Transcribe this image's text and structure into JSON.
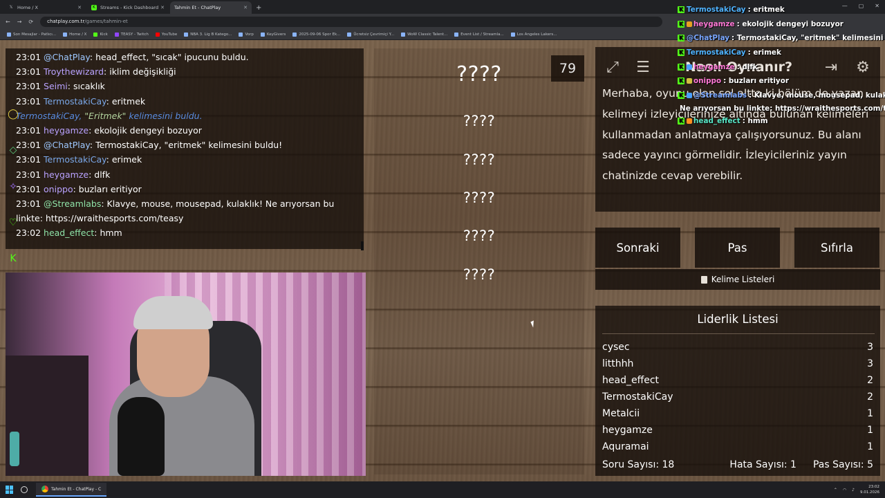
{
  "browser": {
    "tabs": [
      {
        "label": "Home / X",
        "icon": "x-logo-icon"
      },
      {
        "label": "Streams - Kick Dashboard",
        "icon": "kick-logo-icon"
      },
      {
        "label": "Tahmin Et - ChatPlay",
        "icon": "chatplay-icon"
      }
    ],
    "url_host": "chatplay.com.tr",
    "url_path": "/games/tahmin-et",
    "bookmarks": [
      "Son Mesajlar - Patlıcı...",
      "Home / X",
      "Kick",
      "TEASY - Twitch",
      "YouTube",
      "NBA 3. Lig B Katego...",
      "Vorp",
      "KeyGivers",
      "2025-09-06 Spor Ek...",
      "Ücretsiz Çevrimiçi Y...",
      "WoW Classic Talent...",
      "Event List / Streamla...",
      "Los Angeles Lakers..."
    ]
  },
  "chat": {
    "lines": [
      {
        "time": "23:01",
        "user": "@ChatPlay",
        "text": ": head_effect, \"sıcak\" ipucunu buldu.",
        "color": "sys"
      },
      {
        "time": "23:01",
        "user": "Troythewizard",
        "text": ": iklim değişikliği",
        "color": "purple"
      },
      {
        "time": "23:01",
        "user": "Seimi",
        "text": ": sıcaklık",
        "color": "purple"
      },
      {
        "time": "23:01",
        "user": "TermostakiCay",
        "text": ": eritmek",
        "color": "blue"
      },
      {
        "time": "23:01",
        "user": "heygamze",
        "text": ": ekolojik dengeyi bozuyor",
        "color": "purple"
      },
      {
        "time": "23:01",
        "user": "@ChatPlay",
        "text": ": TermostakiCay, \"eritmek\" kelimesini buldu!",
        "color": "sys"
      },
      {
        "time": "23:01",
        "user": "TermostakiCay",
        "text": ": erimek",
        "color": "blue"
      },
      {
        "time": "23:01",
        "user": "heygamze",
        "text": ": dlfk",
        "color": "purple"
      },
      {
        "time": "23:01",
        "user": "onippo",
        "text": ": buzları eritiyor",
        "color": "purple"
      },
      {
        "time": "23:01",
        "user": "@Streamlabs",
        "text": ": Klavye, mouse, mousepad, kulaklık! Ne arıyorsan bu linkte: https://wraithesports.com/teasy",
        "color": "green"
      },
      {
        "time": "23:02",
        "user": "head_effect",
        "text": ": hmm",
        "color": "green"
      }
    ],
    "found_notice": {
      "user": "TermostakiCay,",
      "word": "\"Eritmek\"",
      "rest": " kelimesini buldu."
    }
  },
  "game": {
    "counter": "79",
    "words": [
      "????",
      "????",
      "????",
      "????",
      "????",
      "????"
    ]
  },
  "info": {
    "title": "Nasıl Oynanır?",
    "text": "Merhaba, oyunu olan sol altta ki bölüm de yazan kelimeyi izleyicilerinize altında bulunan kelimeleri kullanmadan anlatmaya çalışıyorsunuz. Bu alanı sadece yayıncı görmelidir. İzleyicileriniz yayın chatinizde cevap verebilir."
  },
  "buttons": {
    "next": "Sonraki",
    "pass": "Pas",
    "reset": "Sıfırla",
    "word_lists": "Kelime Listeleri"
  },
  "leaderboard": {
    "title": "Liderlik Listesi",
    "rows": [
      {
        "name": "cysec",
        "score": "3"
      },
      {
        "name": "litthhh",
        "score": "3"
      },
      {
        "name": "head_effect",
        "score": "2"
      },
      {
        "name": "TermostakiCay",
        "score": "2"
      },
      {
        "name": "Metalcii",
        "score": "1"
      },
      {
        "name": "heygamze",
        "score": "1"
      },
      {
        "name": "Aquramai",
        "score": "1"
      }
    ],
    "questions": "Soru Sayısı: 18",
    "errors": "Hata Sayısı: 1",
    "passes": "Pas Sayısı: 5"
  },
  "overlay": {
    "lines": [
      {
        "user": "TermostakiCay",
        "msg": ": eritmek",
        "color": "cyan"
      },
      {
        "user": "heygamze",
        "msg": ": ekolojik dengeyi bozuyor",
        "color": "pink"
      },
      {
        "user": "@ChatPlay",
        "msg": ": TermostakiCay, \"eritmek\" kelimesini buldu!",
        "color": "blue"
      },
      {
        "user": "TermostakiCay",
        "msg": ": erimek",
        "color": "cyan"
      },
      {
        "user": "heygamze",
        "msg": ": dlfk",
        "color": "pink"
      },
      {
        "user": "onippo",
        "msg": ": buzları eritiyor",
        "color": "pink"
      },
      {
        "user": "@Streamlabs",
        "msg": ": Klavye, mouse, mousepad, kulaklık!",
        "color": "blue"
      },
      {
        "user": "",
        "msg": "Ne arıyorsan bu linkte: https://wraithesports.com/teasy",
        "color": ""
      },
      {
        "user": "head_effect",
        "msg": ": hmm",
        "color": "teal"
      }
    ]
  },
  "taskbar": {
    "app": "Tahmin Et - ChatPlay - C",
    "time": "23:02",
    "date": "9.01.2026"
  },
  "colors": {
    "accent_kick": "#53fc18",
    "chat_user": "#7aa7e8"
  }
}
